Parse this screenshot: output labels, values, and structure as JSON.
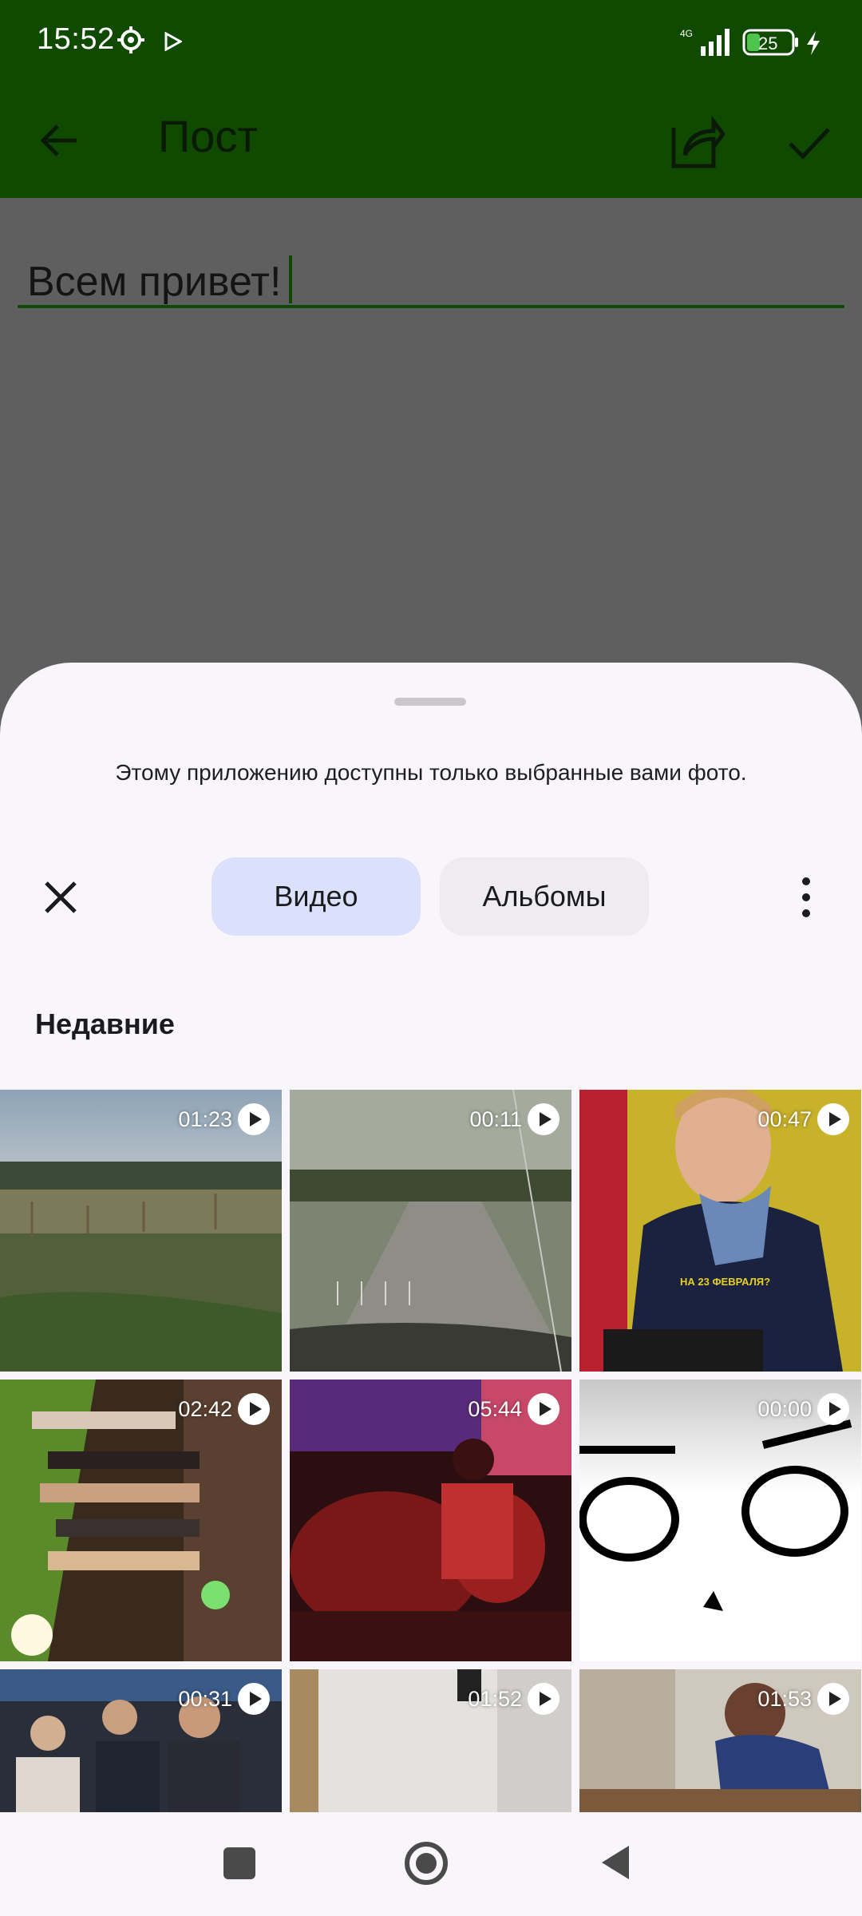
{
  "status_bar": {
    "time": "15:52",
    "network": "4G",
    "battery": "25",
    "icons": [
      "gear-icon",
      "play-store-icon",
      "signal-icon",
      "battery-icon",
      "charging-icon"
    ]
  },
  "app_bar": {
    "title": "Пост",
    "icons": [
      "arrow-back-icon",
      "share-icon",
      "check-icon"
    ],
    "color": "#0f4a00"
  },
  "editor": {
    "value": "Всем привет!"
  },
  "sheet": {
    "notice": "Этому приложению доступны только выбранные вами фото.",
    "tabs": [
      {
        "label": "Видео",
        "selected": true
      },
      {
        "label": "Альбомы",
        "selected": false
      }
    ],
    "section_title": "Недавние",
    "videos": [
      {
        "duration": "01:23"
      },
      {
        "duration": "00:11"
      },
      {
        "duration": "00:47"
      },
      {
        "duration": "02:42"
      },
      {
        "duration": "05:44"
      },
      {
        "duration": "00:00"
      },
      {
        "duration": "00:31"
      },
      {
        "duration": "01:52"
      },
      {
        "duration": "01:53"
      }
    ],
    "thumbnail_caption": "НА 23 ФЕВРАЛЯ?"
  },
  "nav_bar": {
    "icons": [
      "recent-apps-icon",
      "home-icon",
      "back-icon"
    ]
  }
}
